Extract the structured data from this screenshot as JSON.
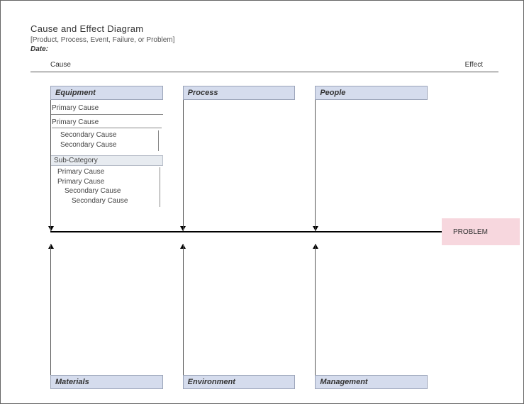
{
  "header": {
    "title": "Cause and Effect Diagram",
    "subtitle": "[Product, Process, Event, Failure, or Problem]",
    "date_label": "Date:"
  },
  "axis": {
    "cause": "Cause",
    "effect": "Effect"
  },
  "categories": {
    "top": [
      "Equipment",
      "Process",
      "People"
    ],
    "bottom": [
      "Materials",
      "Environment",
      "Management"
    ]
  },
  "equipment_details": {
    "primary1": "Primary Cause",
    "primary2": "Primary Cause",
    "sec1": "Secondary Cause",
    "sec2": "Secondary Cause",
    "subcat": "Sub-Category",
    "p1": "Primary Cause",
    "p2": "Primary Cause",
    "s1": "Secondary Cause",
    "s2": "Secondary Cause"
  },
  "problem": "PROBLEM"
}
